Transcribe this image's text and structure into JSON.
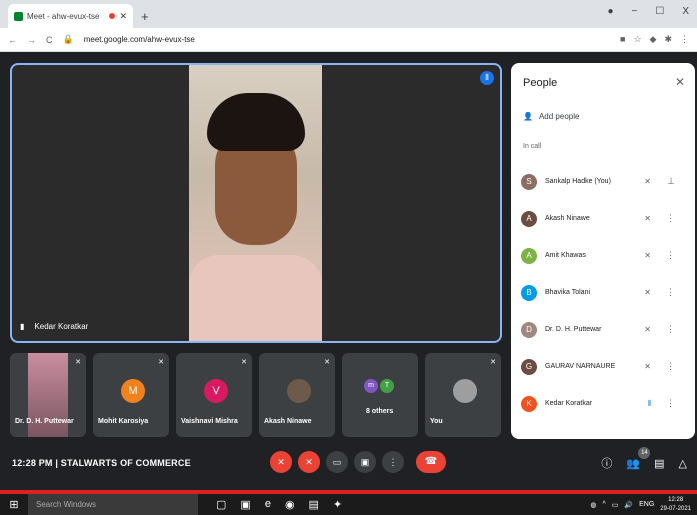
{
  "browser": {
    "tab_title": "Meet - ahw-evux-tse",
    "url": "meet.google.com/ahw-evux-tse",
    "new_tab": "+",
    "tab_close": "✕",
    "min": "−",
    "max": "☐",
    "close": "X"
  },
  "stage": {
    "speaker_name": "Kedar Koratkar"
  },
  "tiles": [
    {
      "name": "Dr. D. H. Puttewar",
      "initial": "",
      "color": "#8a6f6a"
    },
    {
      "name": "Mohit Karosiya",
      "initial": "M",
      "color": "#f0821e"
    },
    {
      "name": "Vaishnavi Mishra",
      "initial": "V",
      "color": "#d81b60"
    },
    {
      "name": "Akash Ninawe",
      "initial": "",
      "color": "#6d5a4a"
    },
    {
      "name": "8 others",
      "initial": "m",
      "color": "#7e57c2"
    },
    {
      "name": "You",
      "initial": "",
      "color": "#9e9e9e"
    }
  ],
  "bottom": {
    "time_meeting": "12:28 PM  |  STALWARTS OF COMMERCE",
    "people_count": "14"
  },
  "people": {
    "title": "People",
    "add": "Add people",
    "in_call": "In call",
    "list": [
      {
        "name": "Sankalp Hadke (You)",
        "initial": "S",
        "color": "#8d6e63"
      },
      {
        "name": "Akash Ninawe",
        "initial": "A",
        "color": "#6d4c41"
      },
      {
        "name": "Amit Khawas",
        "initial": "A",
        "color": "#7cb342"
      },
      {
        "name": "Bhavika Tolani",
        "initial": "B",
        "color": "#039be5"
      },
      {
        "name": "Dr. D. H. Puttewar",
        "initial": "D",
        "color": "#a1887f"
      },
      {
        "name": "GAURAV NARNAURE",
        "initial": "G",
        "color": "#6d4c41"
      },
      {
        "name": "Kedar Koratkar",
        "initial": "K",
        "color": "#f4511e"
      }
    ]
  },
  "taskbar": {
    "search": "Search Windows",
    "lang": "ENG",
    "time": "12:28",
    "date": "29-07-2021"
  }
}
